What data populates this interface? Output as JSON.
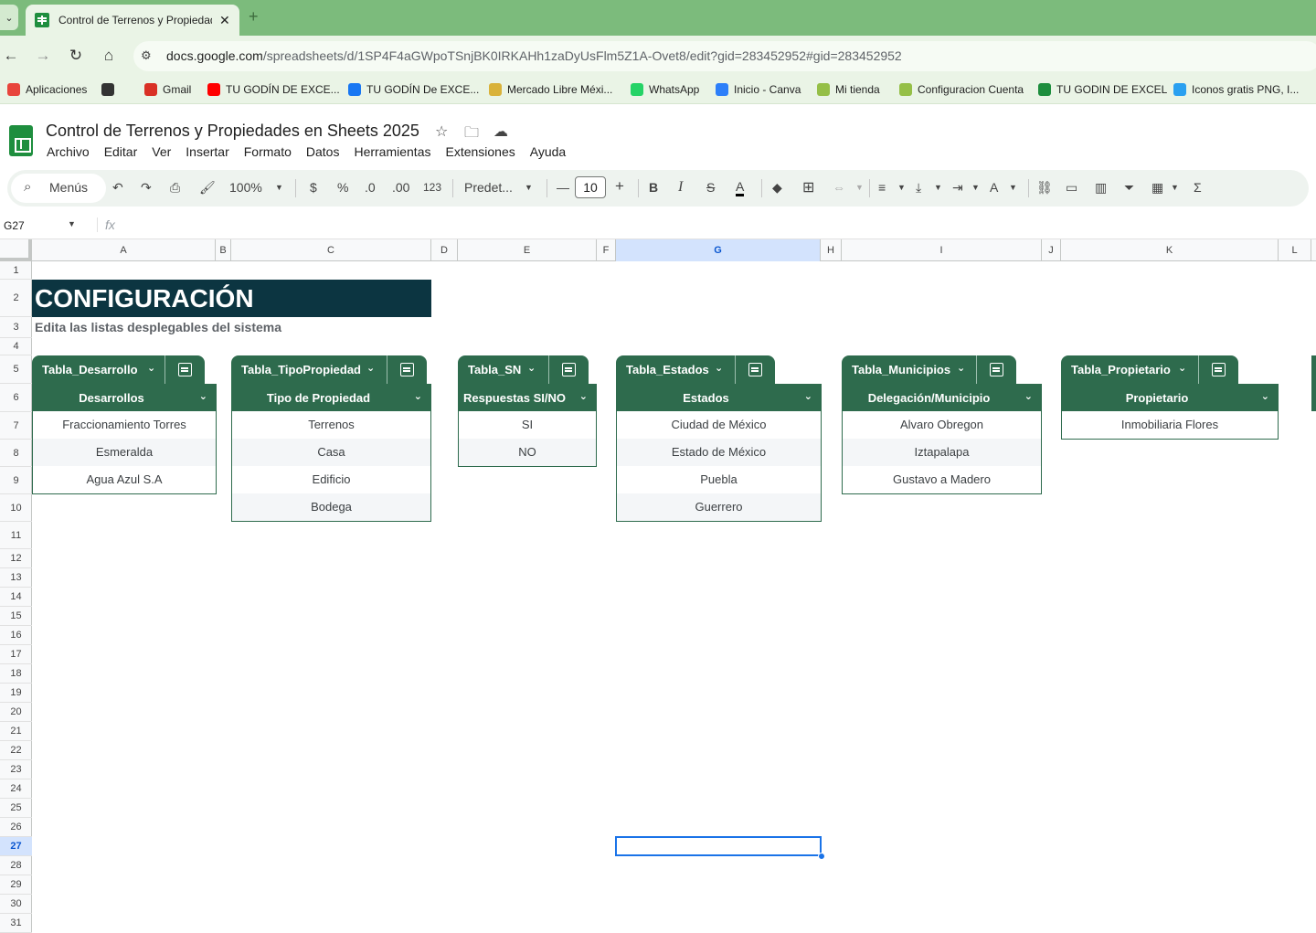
{
  "browser": {
    "tab_title": "Control de Terrenos y Propiedades en Sheets 2025",
    "tab_close": "✕",
    "new_tab": "+",
    "tab_menu": "⌄",
    "url_domain": "docs.google.com",
    "url_path": "/spreadsheets/d/1SP4F4aGWpoTSnjBK0IRKAHh1zaDyUsFlm5Z1A-Ovet8/edit?gid=283452952#gid=283452952",
    "bookmarks": [
      {
        "label": "Aplicaciones",
        "icon": "apps-grid-icon",
        "color": "#e8453c"
      },
      {
        "label": "",
        "icon": "grid-icon",
        "color": "#333333"
      },
      {
        "label": "Gmail",
        "icon": "gmail-icon",
        "color": "#d93025"
      },
      {
        "label": "TU GODÍN DE EXCE...",
        "icon": "youtube-icon",
        "color": "#ff0000"
      },
      {
        "label": "TU GODÍN De EXCE...",
        "icon": "facebook-icon",
        "color": "#1877f2"
      },
      {
        "label": "Mercado Libre Méxi...",
        "icon": "mercadolibre-icon",
        "color": "#d9b23a"
      },
      {
        "label": "WhatsApp",
        "icon": "whatsapp-icon",
        "color": "#25d366"
      },
      {
        "label": "Inicio - Canva",
        "icon": "canva-icon",
        "color": "#2d7ff9"
      },
      {
        "label": "Mi tienda",
        "icon": "shopify-icon",
        "color": "#95bf47"
      },
      {
        "label": "Configuracion Cuenta",
        "icon": "shopify-icon",
        "color": "#95bf47"
      },
      {
        "label": "TU GODIN DE EXCEL",
        "icon": "excel-circle-icon",
        "color": "#1e8e3e"
      },
      {
        "label": "Iconos gratis PNG, I...",
        "icon": "flaticon-icon",
        "color": "#2aa0f0"
      }
    ]
  },
  "doc": {
    "title": "Control de Terrenos y Propiedades en Sheets 2025",
    "menu": [
      "Archivo",
      "Editar",
      "Ver",
      "Insertar",
      "Formato",
      "Datos",
      "Herramientas",
      "Extensiones",
      "Ayuda"
    ]
  },
  "toolbar": {
    "search": "Menús",
    "zoom": "100%",
    "currency": "$",
    "percent": "%",
    "dec_decrease": ".0",
    "dec_increase": ".00",
    "format_123": "123",
    "font": "Predet...",
    "font_size": "10",
    "bold": "B",
    "italic": "I",
    "strike": "S",
    "text_color": "A",
    "sigma": "Σ"
  },
  "formula_bar": {
    "name_box": "G27",
    "fx": "fx"
  },
  "grid": {
    "columns": [
      "A",
      "B",
      "C",
      "D",
      "E",
      "F",
      "G",
      "H",
      "I",
      "J",
      "K",
      "L"
    ],
    "rows": [
      "1",
      "2",
      "3",
      "4",
      "5",
      "6",
      "7",
      "8",
      "9",
      "10",
      "11",
      "12",
      "13",
      "14",
      "15",
      "16",
      "17",
      "18",
      "19",
      "20",
      "21",
      "22",
      "23",
      "24",
      "25",
      "26",
      "27",
      "28",
      "29",
      "30",
      "31"
    ],
    "selected_column": "G",
    "selected_row": "27"
  },
  "sheet": {
    "banner": "CONFIGURACIÓN",
    "subtitle": "Edita las listas desplegables del sistema",
    "tables": [
      {
        "name": "Tabla_Desarrollo",
        "header": "Desarrollos",
        "items": [
          "Fraccionamiento Torres",
          "Esmeralda",
          "Agua Azul S.A"
        ]
      },
      {
        "name": "Tabla_TipoPropiedad",
        "header": "Tipo de Propiedad",
        "items": [
          "Terrenos",
          "Casa",
          "Edificio",
          "Bodega"
        ]
      },
      {
        "name": "Tabla_SN",
        "header": "Respuestas SI/NO",
        "items": [
          "SI",
          "NO"
        ]
      },
      {
        "name": "Tabla_Estados",
        "header": "Estados",
        "items": [
          "Ciudad de México",
          "Estado de México",
          "Puebla",
          "Guerrero"
        ]
      },
      {
        "name": "Tabla_Municipios",
        "header": "Delegación/Municipio",
        "items": [
          "Alvaro Obregon",
          "Iztapalapa",
          "Gustavo a Madero"
        ]
      },
      {
        "name": "Tabla_Propietario",
        "header": "Propietario",
        "items": [
          "Inmobiliaria Flores"
        ]
      }
    ]
  },
  "colors": {
    "table_green": "#2e6b4d",
    "banner": "#0c3541",
    "chrome_green": "#7cbb7c",
    "selection": "#1a73e8"
  }
}
